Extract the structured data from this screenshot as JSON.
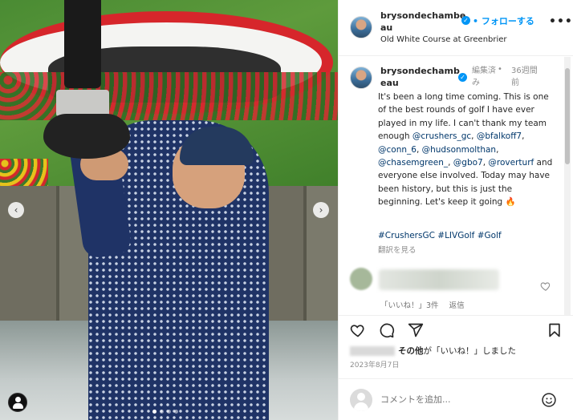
{
  "post": {
    "username_line1": "brysondechambe",
    "username_line2": "au",
    "follow_separator": "•",
    "follow_label": "フォローする",
    "more_label": "•••",
    "location": "Old White Course at Greenbrier",
    "verified_mark": "✓"
  },
  "caption": {
    "username_line1": "brysondechamb",
    "username_line2": "eau",
    "edited_line1": "編集済",
    "edited_line2": "み",
    "separator": "•",
    "ago_line1": "36週間",
    "ago_line2": "前",
    "text_1": "It's been a long time coming. This is one of the best rounds of golf I have ever played in my life. I can't thank my team enough ",
    "m1": "@crushers_gc",
    "t2": ", ",
    "m2": "@bfalkoff7",
    "t3": ", ",
    "m3": "@conn_6",
    "t4": ", ",
    "m4": "@hudsonmolthan",
    "t5": ", ",
    "m5": "@chasemgreen_",
    "t6": ", ",
    "m6": "@gbo7",
    "t7": ", ",
    "m7": "@roverturf",
    "t8": " and everyone else involved. Today may have been history, but this is just the beginning. Let's keep it going 🔥",
    "hashtags": "#CrushersGC #LIVGolf #Golf",
    "translate": "翻訳を見る"
  },
  "comment": {
    "likes": "「いいね！」3件",
    "reply": "返信"
  },
  "likes_line": {
    "others": "その他",
    "suffix": "が「いいね！」しました"
  },
  "date": "2023年8月7日",
  "comment_box": {
    "placeholder": "コメントを追加..."
  },
  "photo": {
    "arrow_left": "‹",
    "arrow_right": "›",
    "slide_count": 4,
    "active_slide": 1
  },
  "colors": {
    "accent": "#0095f6",
    "mention": "#00376b",
    "muted": "#8e8e8e"
  },
  "icons": [
    "heart-icon",
    "comment-icon",
    "share-icon",
    "bookmark-icon",
    "emoji-icon",
    "user-tag-icon",
    "chevron-left-icon",
    "chevron-right-icon",
    "verified-icon",
    "more-icon"
  ]
}
